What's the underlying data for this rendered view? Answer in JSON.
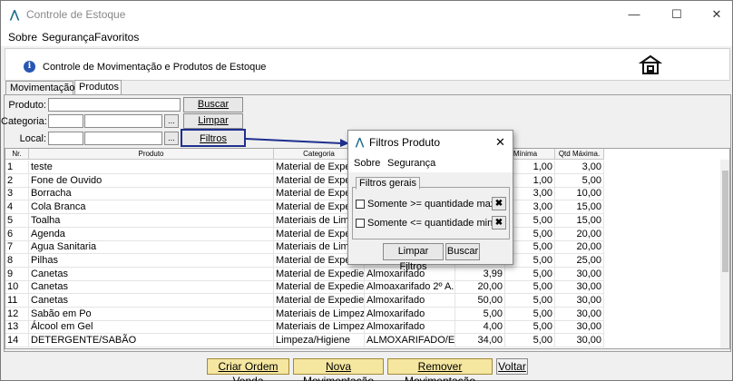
{
  "window": {
    "title": "Controle de Estoque",
    "minimize_glyph": "—",
    "maximize_glyph": "☐",
    "close_glyph": "✕"
  },
  "menu": [
    "Sobre",
    "Segurança",
    "Favoritos"
  ],
  "header": {
    "title": "Controle de Movimentação e Produtos de Estoque",
    "info_icon_glyph": "i"
  },
  "tabs": [
    "Movimentação",
    "Produtos"
  ],
  "filters": {
    "produto_label": "Produto:",
    "categoria_label": "Categoria:",
    "local_label": "Local:",
    "dots": "...",
    "buscar": "Buscar",
    "limpar": "Limpar",
    "filtros": "Filtros"
  },
  "table": {
    "headers": [
      "Nr.",
      "Produto",
      "Categoria",
      "",
      "",
      "d. Mínima",
      "Qtd Máxima."
    ],
    "rows": [
      {
        "nr": "1",
        "produto": "teste",
        "categoria": "Material de Exped",
        "local": "",
        "qtd": "",
        "min": "1,00",
        "max": "3,00"
      },
      {
        "nr": "2",
        "produto": "Fone de Ouvido",
        "categoria": "Material de Exped",
        "local": "",
        "qtd": "",
        "min": "1,00",
        "max": "5,00"
      },
      {
        "nr": "3",
        "produto": "Borracha",
        "categoria": "Material de Exped",
        "local": "",
        "qtd": "",
        "min": "3,00",
        "max": "10,00"
      },
      {
        "nr": "4",
        "produto": "Cola Branca",
        "categoria": "Material de Exped",
        "local": "",
        "qtd": "",
        "min": "3,00",
        "max": "15,00"
      },
      {
        "nr": "5",
        "produto": "Toalha",
        "categoria": "Materiais de Limpe",
        "local": "",
        "qtd": "",
        "min": "5,00",
        "max": "15,00"
      },
      {
        "nr": "6",
        "produto": "Agenda",
        "categoria": "Material de Exped",
        "local": "",
        "qtd": "",
        "min": "5,00",
        "max": "20,00"
      },
      {
        "nr": "7",
        "produto": "Agua Sanitaria",
        "categoria": "Materiais de Limp",
        "local": "",
        "qtd": "",
        "min": "5,00",
        "max": "20,00"
      },
      {
        "nr": "8",
        "produto": "Pilhas",
        "categoria": "Material de Exped",
        "local": "",
        "qtd": "",
        "min": "5,00",
        "max": "25,00"
      },
      {
        "nr": "9",
        "produto": "Canetas",
        "categoria": "Material de Expedie...",
        "local": "Almoxarifado",
        "qtd": "3,99",
        "min": "5,00",
        "max": "30,00"
      },
      {
        "nr": "10",
        "produto": "Canetas",
        "categoria": "Material de Expedie...",
        "local": "Almoaxarifado 2º A...",
        "qtd": "20,00",
        "min": "5,00",
        "max": "30,00"
      },
      {
        "nr": "11",
        "produto": "Canetas",
        "categoria": "Material de Expedie...",
        "local": "Almoxarifado",
        "qtd": "50,00",
        "min": "5,00",
        "max": "30,00"
      },
      {
        "nr": "12",
        "produto": "Sabão em Po",
        "categoria": "Materiais de Limpeza",
        "local": "Almoxarifado",
        "qtd": "5,00",
        "min": "5,00",
        "max": "30,00"
      },
      {
        "nr": "13",
        "produto": "Álcool em Gel",
        "categoria": "Materiais de Limpeza",
        "local": "Almoxarifado",
        "qtd": "4,00",
        "min": "5,00",
        "max": "30,00"
      },
      {
        "nr": "14",
        "produto": "DETERGENTE/SABÃO",
        "categoria": "Limpeza/Higiene",
        "local": "ALMOXARIFADO/ES...",
        "qtd": "34,00",
        "min": "5,00",
        "max": "30,00"
      }
    ]
  },
  "actions": {
    "criar": "Criar Ordem Venda",
    "nova": "Nova Movimentação",
    "remover": "Remover Movimentação",
    "voltar": "Voltar"
  },
  "popup": {
    "title": "Filtros Produto",
    "close_glyph": "✕",
    "menu": [
      "Sobre",
      "Segurança"
    ],
    "tab": "Filtros gerais",
    "option1": "Somente >= quantidade max.",
    "option2": "Somente <= quantidade min.",
    "clear_glyph": "✖",
    "limpar": "Limpar Filtros",
    "buscar": "Buscar"
  },
  "colors": {
    "accent_arrow": "#1f2f8f",
    "action_button": "#f5e6a0"
  }
}
